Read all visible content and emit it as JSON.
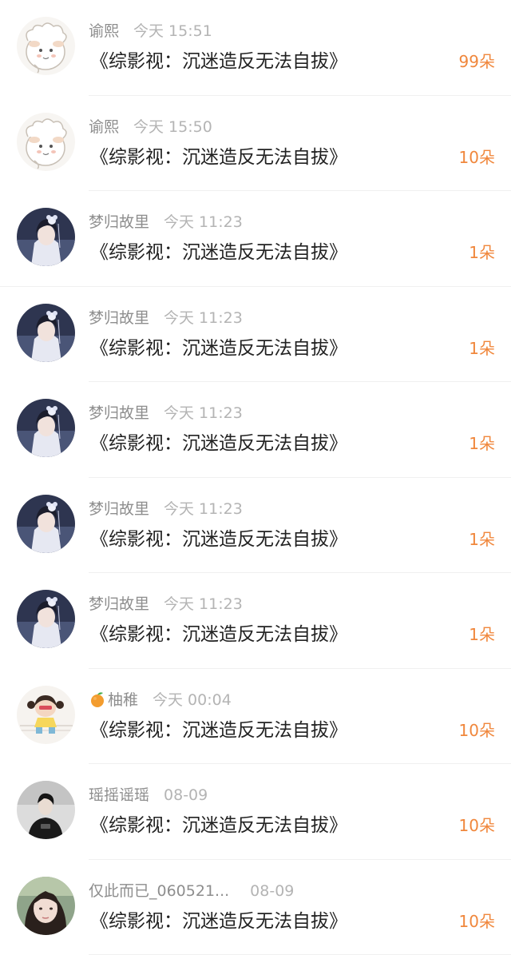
{
  "messages": [
    {
      "user": "谕熙",
      "time": "今天 15:51",
      "title": "《综影视：沉迷造反无法自拔》",
      "count": "99朵",
      "avatar": "sheep-avatar"
    },
    {
      "user": "谕熙",
      "time": "今天 15:50",
      "title": "《综影视：沉迷造反无法自拔》",
      "count": "10朵",
      "avatar": "sheep-avatar"
    },
    {
      "user": "梦归故里",
      "time": "今天 11:23",
      "title": "《综影视：沉迷造反无法自拔》",
      "count": "1朵",
      "avatar": "costume-girl-avatar"
    },
    {
      "user": "梦归故里",
      "time": "今天 11:23",
      "title": "《综影视：沉迷造反无法自拔》",
      "count": "1朵",
      "avatar": "costume-girl-avatar"
    },
    {
      "user": "梦归故里",
      "time": "今天 11:23",
      "title": "《综影视：沉迷造反无法自拔》",
      "count": "1朵",
      "avatar": "costume-girl-avatar"
    },
    {
      "user": "梦归故里",
      "time": "今天 11:23",
      "title": "《综影视：沉迷造反无法自拔》",
      "count": "1朵",
      "avatar": "costume-girl-avatar"
    },
    {
      "user": "梦归故里",
      "time": "今天 11:23",
      "title": "《综影视：沉迷造反无法自拔》",
      "count": "1朵",
      "avatar": "costume-girl-avatar"
    },
    {
      "user": "柚稚",
      "time": "今天 00:04",
      "title": "《综影视：沉迷造反无法自拔》",
      "count": "10朵",
      "avatar": "cartoon-girl-avatar",
      "name_icon": "orange-icon"
    },
    {
      "user": "瑶摇谣瑶",
      "time": "08-09",
      "title": "《综影视：沉迷造反无法自拔》",
      "count": "10朵",
      "avatar": "dark-portrait-avatar"
    },
    {
      "user": "仅此而已_060521...",
      "time": "08-09",
      "title": "《综影视：沉迷造反无法自拔》",
      "count": "10朵",
      "avatar": "woman-portrait-avatar"
    }
  ],
  "colors": {
    "count": "#f0873c",
    "name": "#8e8e8e",
    "time": "#b4b4b4",
    "title": "#222222"
  }
}
